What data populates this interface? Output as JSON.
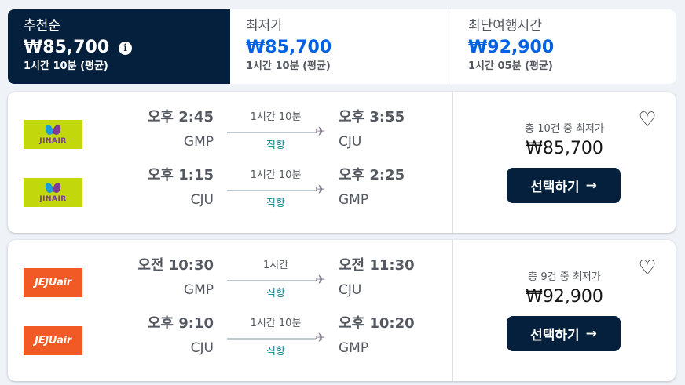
{
  "sort_tabs": [
    {
      "label": "추천순",
      "price": "₩85,700",
      "duration": "1시간 10분 (평균)"
    },
    {
      "label": "최저가",
      "price": "₩85,700",
      "duration": "1시간 10분 (평균)"
    },
    {
      "label": "최단여행시간",
      "price": "₩92,900",
      "duration": "1시간 05분 (평균)"
    }
  ],
  "results": [
    {
      "airline_logo_text": "JINAIR",
      "legs": [
        {
          "dep_time": "오후 2:45",
          "dep_code": "GMP",
          "duration": "1시간 10분",
          "stops": "직항",
          "arr_time": "오후 3:55",
          "arr_code": "CJU"
        },
        {
          "dep_time": "오후 1:15",
          "dep_code": "CJU",
          "duration": "1시간 10분",
          "stops": "직항",
          "arr_time": "오후 2:25",
          "arr_code": "GMP"
        }
      ],
      "deal_label": "총 10건 중 최저가",
      "price": "₩85,700",
      "button_label": "선택하기"
    },
    {
      "airline_logo_text": "JEJUair",
      "legs": [
        {
          "dep_time": "오전 10:30",
          "dep_code": "GMP",
          "duration": "1시간",
          "stops": "직항",
          "arr_time": "오전 11:30",
          "arr_code": "CJU"
        },
        {
          "dep_time": "오후 9:10",
          "dep_code": "CJU",
          "duration": "1시간 10분",
          "stops": "직항",
          "arr_time": "오후 10:20",
          "arr_code": "GMP"
        }
      ],
      "deal_label": "총 9건 중 최저가",
      "price": "₩92,900",
      "button_label": "선택하기"
    }
  ],
  "icons": {
    "info": "i",
    "plane": "✈",
    "heart": "♡",
    "arrow": "→"
  },
  "colors": {
    "navy": "#05203c",
    "accent_blue": "#0062e3",
    "nonstop_teal": "#0c838a",
    "jinair_green": "#c3d80c",
    "jejuair_orange": "#f15a24"
  }
}
